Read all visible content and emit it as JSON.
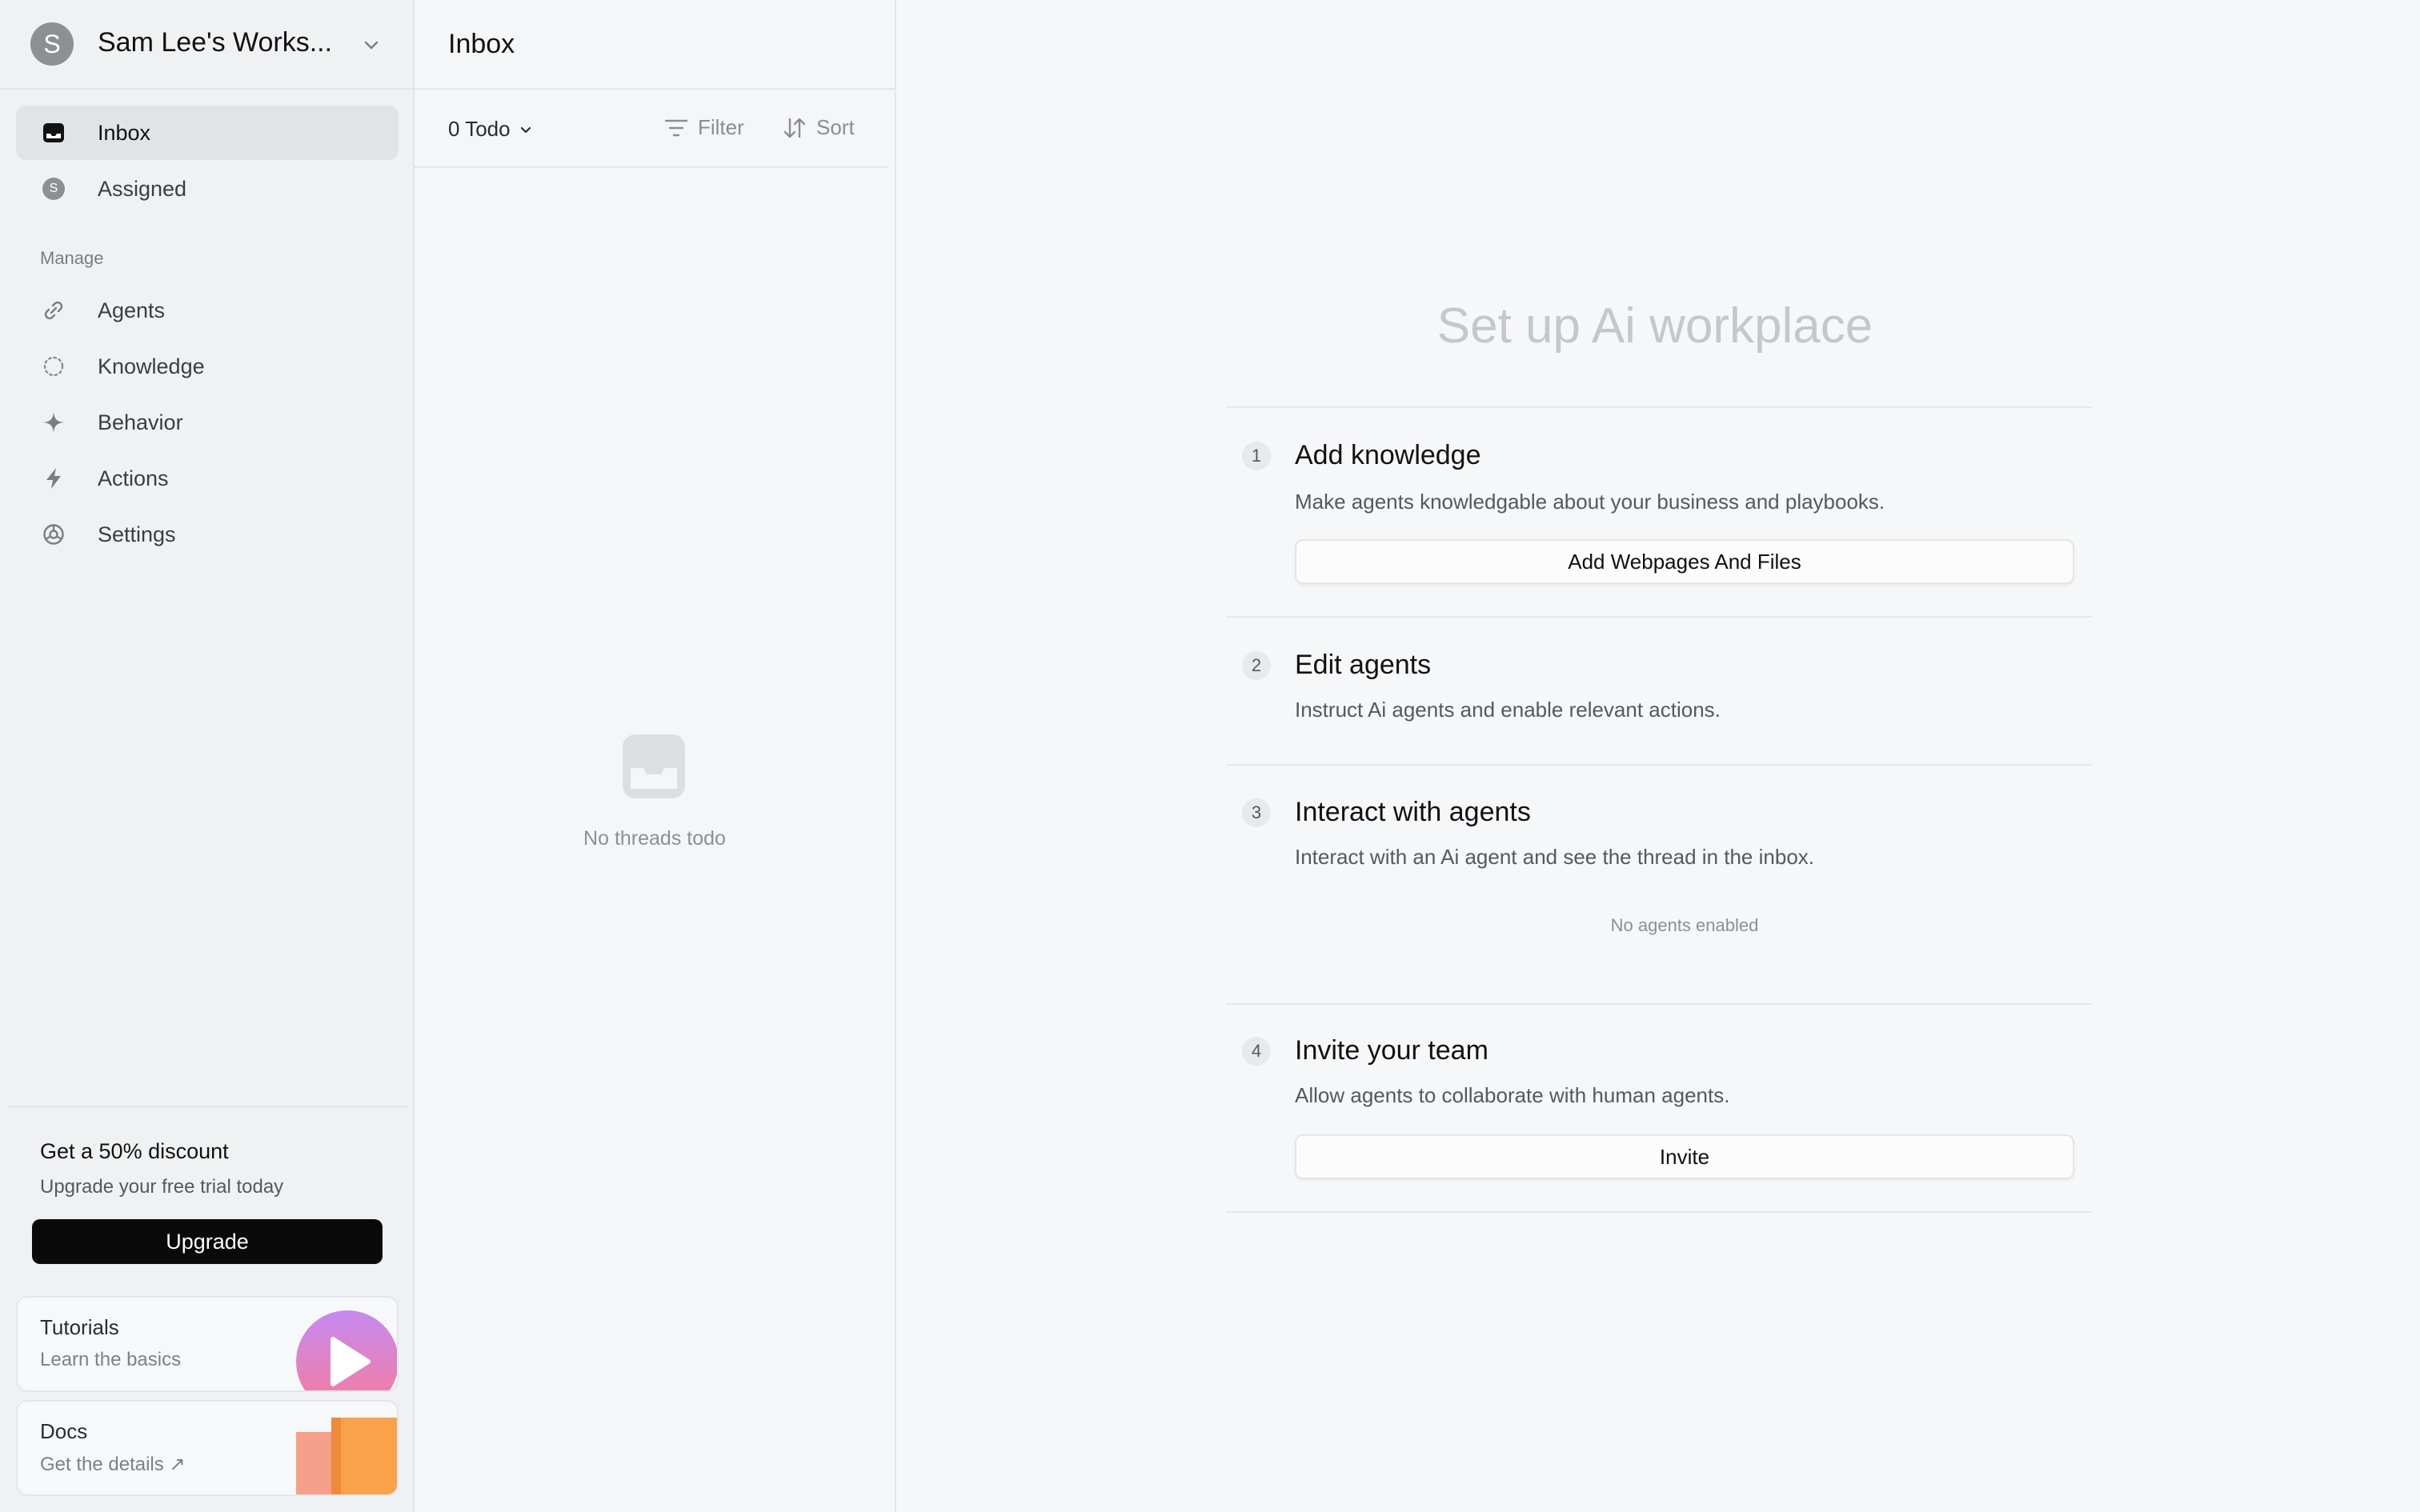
{
  "workspace": {
    "avatar_letter": "S",
    "name": "Sam Lee's Works..."
  },
  "sidebar": {
    "items": [
      {
        "label": "Inbox",
        "icon": "inbox-icon",
        "active": true
      },
      {
        "label": "Assigned",
        "icon": "user-avatar-icon",
        "avatar_letter": "S"
      }
    ],
    "manage_label": "Manage",
    "manage_items": [
      {
        "label": "Agents",
        "icon": "link-icon"
      },
      {
        "label": "Knowledge",
        "icon": "dotted-circle-icon"
      },
      {
        "label": "Behavior",
        "icon": "sparkle-icon"
      },
      {
        "label": "Actions",
        "icon": "lightning-icon"
      },
      {
        "label": "Settings",
        "icon": "gear-icon"
      }
    ],
    "promo": {
      "title": "Get a 50% discount",
      "subtitle": "Upgrade your free trial today",
      "button": "Upgrade"
    },
    "tutorials": {
      "title": "Tutorials",
      "subtitle": "Learn the basics"
    },
    "docs": {
      "title": "Docs",
      "subtitle": "Get the details ↗"
    }
  },
  "inbox": {
    "title": "Inbox",
    "todo_filter": "0 Todo",
    "filter_label": "Filter",
    "sort_label": "Sort",
    "empty_text": "No threads todo"
  },
  "main": {
    "title": "Set up Ai workplace",
    "steps": [
      {
        "num": "1",
        "title": "Add knowledge",
        "desc": "Make agents knowledgable about your business and playbooks.",
        "button": "Add Webpages And Files"
      },
      {
        "num": "2",
        "title": "Edit agents",
        "desc": "Instruct Ai agents and enable relevant actions."
      },
      {
        "num": "3",
        "title": "Interact with agents",
        "desc": "Interact with an Ai agent and see the thread in the inbox.",
        "note": "No agents enabled"
      },
      {
        "num": "4",
        "title": "Invite your team",
        "desc": "Allow agents to collaborate with human agents.",
        "button": "Invite"
      }
    ]
  },
  "colors": {
    "accent_dark": "#0a0a0a",
    "sidebar_bg": "#eff1f3",
    "muted_title": "#c5c7cb",
    "tutorial_gradient_top": "#c58af0",
    "tutorial_gradient_bottom": "#f77b9a",
    "docs_orange": "#f9a24a"
  }
}
